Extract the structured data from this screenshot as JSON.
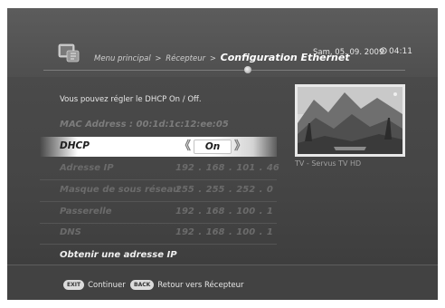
{
  "header": {
    "breadcrumb_root": "Menu principal",
    "breadcrumb_sep1": ">",
    "breadcrumb_mid": "Récepteur",
    "breadcrumb_sep2": ">",
    "breadcrumb_current": "Configuration Ethernet",
    "date": "Sam, 05. 09. 2009",
    "time_icon": "clock-icon",
    "time": "04:11"
  },
  "content": {
    "info_text": "Vous pouvez régler le DHCP On / Off.",
    "mac": "MAC Address : 00:1d:1c:12:ee:05",
    "dhcp": {
      "label": "DHCP",
      "value": "On"
    },
    "rows": [
      {
        "label": "Adresse IP",
        "value": "192 . 168 . 101 .  46"
      },
      {
        "label": "Masque de sous réseau",
        "value": "255 . 255 . 252 .   0"
      },
      {
        "label": "Passerelle",
        "value": "192 . 168 . 100 .   1"
      },
      {
        "label": "DNS",
        "value": "192 . 168 . 100 .   1"
      }
    ],
    "obtain": "Obtenir une adresse IP"
  },
  "preview": {
    "channel": "TV - Servus TV HD"
  },
  "footer": {
    "exit_key": "EXIT",
    "exit_label": "Continuer",
    "back_key": "BACK",
    "back_label": "Retour vers Récepteur"
  },
  "colors": {
    "screen_bg": "#4a4a4a",
    "highlight": "#ffffff",
    "text_dim": "#6b6b6b"
  }
}
